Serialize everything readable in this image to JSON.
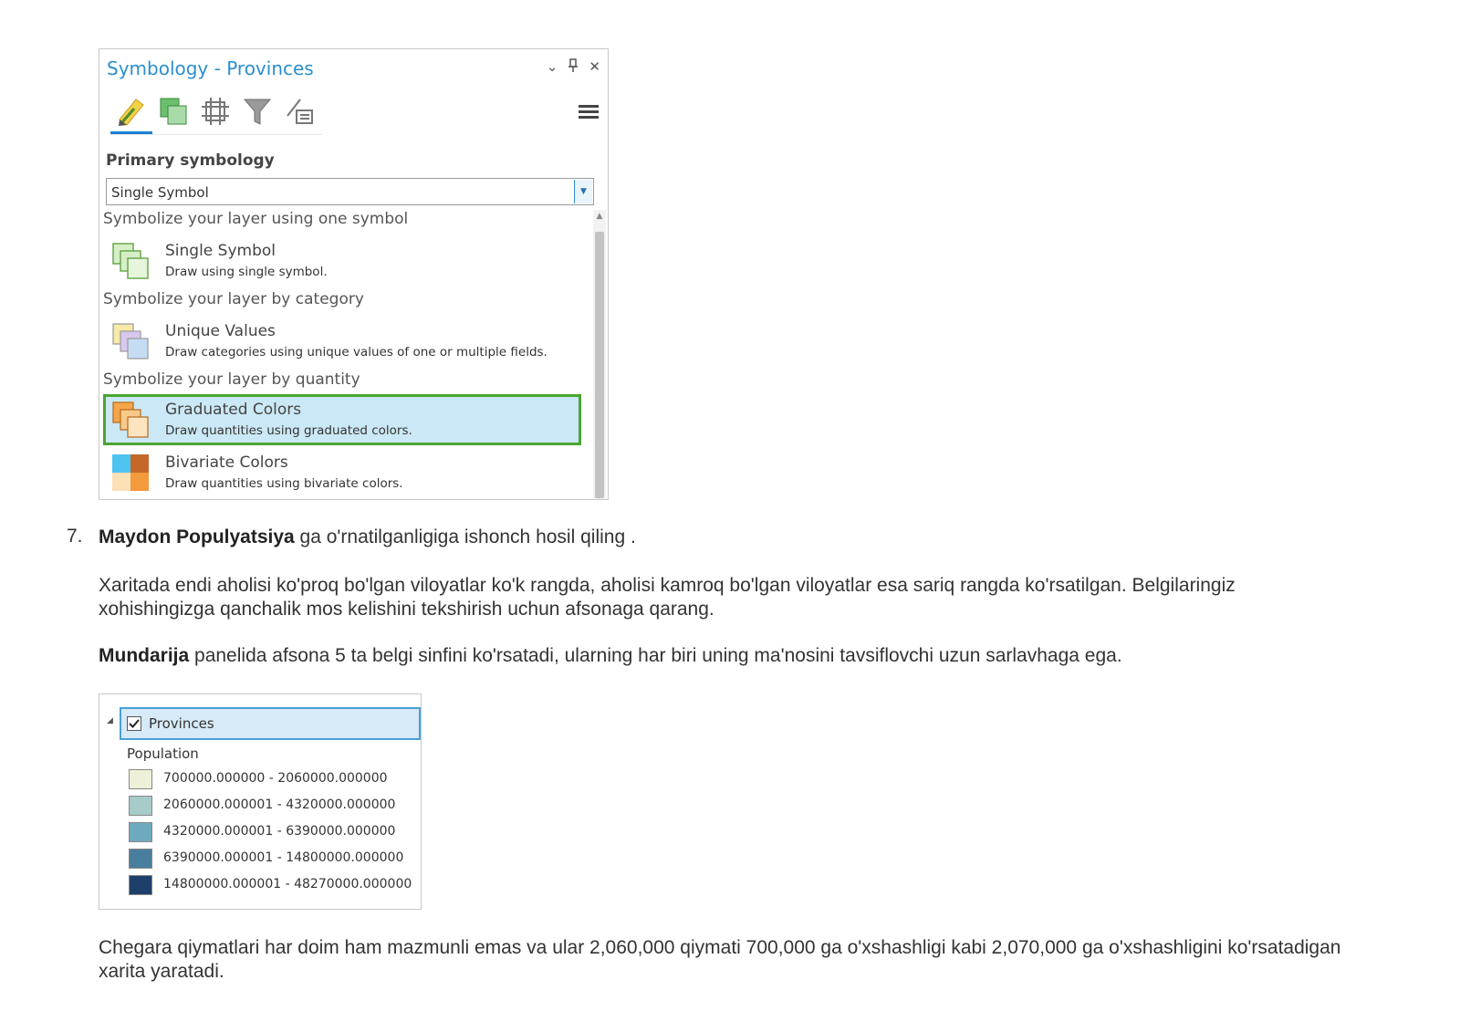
{
  "symbology": {
    "title": "Symbology - Provinces",
    "window_buttons": [
      "⌄",
      "📌",
      "✕"
    ],
    "tabs": [
      {
        "icon": "pencil-icon",
        "active": true
      },
      {
        "icon": "polygon-symbol-icon",
        "active": false
      },
      {
        "icon": "vary-symbology-icon",
        "active": false
      },
      {
        "icon": "filter-icon",
        "active": false
      },
      {
        "icon": "label-class-icon",
        "active": false
      }
    ],
    "primary_label": "Primary symbology",
    "dropdown_value": "Single Symbol",
    "sections": {
      "one_symbol": "Symbolize your layer using one symbol",
      "category": "Symbolize your layer by category",
      "quantity": "Symbolize your layer by quantity"
    },
    "options": {
      "single": {
        "name": "Single Symbol",
        "desc": "Draw using single symbol."
      },
      "unique": {
        "name": "Unique Values",
        "desc": "Draw categories using unique values of one or multiple fields."
      },
      "graduated": {
        "name": "Graduated Colors",
        "desc": "Draw quantities using graduated colors.",
        "selected": true
      },
      "bivariate": {
        "name": "Bivariate Colors",
        "desc": "Draw quantities using bivariate colors."
      }
    }
  },
  "step": {
    "number": "7.",
    "bold": "Maydon Populyatsiya",
    "rest": " ga o'rnatilganligiga ishonch hosil qiling ."
  },
  "para1": "Xaritada endi aholisi ko'proq bo'lgan viloyatlar ko'k rangda, aholisi kamroq bo'lgan viloyatlar esa sariq rangda ko'rsatilgan. Belgilaringiz xohishingizga qanchalik mos kelishini tekshirish uchun afsonaga qarang.",
  "para2": {
    "bold": "Mundarija",
    "rest": " panelida afsona 5 ta belgi sinfini ko'rsatadi, ularning har biri uning ma'nosini tavsiflovchi uzun sarlavhaga ega."
  },
  "contents": {
    "layer": "Provinces",
    "checked": true,
    "field": "Population",
    "classes": [
      {
        "label": "700000.000000 - 2060000.000000",
        "color": "#eef0d8"
      },
      {
        "label": "2060000.000001 - 4320000.000000",
        "color": "#a6cbc8"
      },
      {
        "label": "4320000.000001 - 6390000.000000",
        "color": "#6fa9bd"
      },
      {
        "label": "6390000.000001 - 14800000.000000",
        "color": "#4a7e9e"
      },
      {
        "label": "14800000.000001 - 48270000.000000",
        "color": "#1f3f6b"
      }
    ]
  },
  "para3": "Chegara qiymatlari har doim ham mazmunli emas va ular 2,060,000 qiymati 700,000 ga o'xshashligi kabi 2,070,000 ga o'xshashligini ko'rsatadigan xarita yaratadi.",
  "colors": {
    "accent": "#2b8fcf",
    "selection_fill": "#cbe8f6",
    "selection_border": "#4aa52e"
  }
}
